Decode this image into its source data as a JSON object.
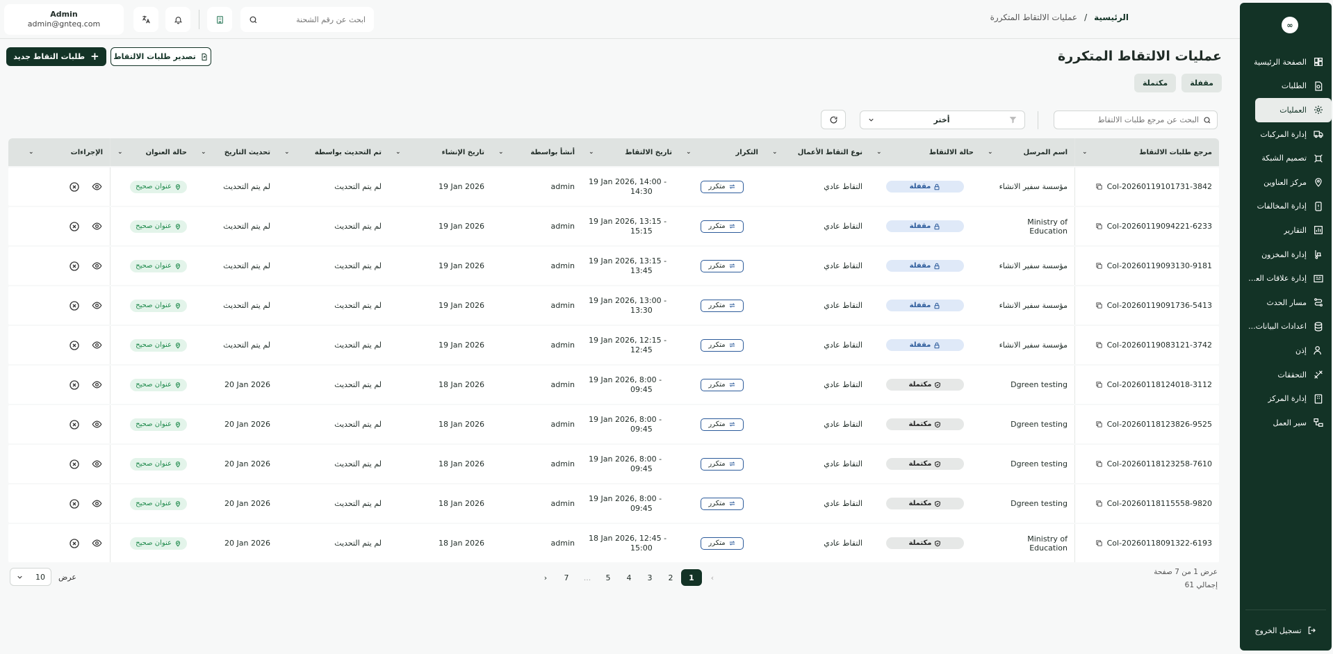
{
  "sidebar": {
    "logo": "∞",
    "items": [
      {
        "label": "الصفحة الرئيسية",
        "icon": "dashboard-icon",
        "active": false
      },
      {
        "label": "الطلبات",
        "icon": "orders-icon",
        "active": false
      },
      {
        "label": "العمليات",
        "icon": "operations-icon",
        "active": true
      },
      {
        "label": "إدارة المركبات",
        "icon": "truck-icon",
        "active": false
      },
      {
        "label": "تصميم الشبكة",
        "icon": "network-icon",
        "active": false
      },
      {
        "label": "مركز العناوين",
        "icon": "location-icon",
        "active": false
      },
      {
        "label": "إدارة المخالفات",
        "icon": "violation-icon",
        "active": false
      },
      {
        "label": "التقارير",
        "icon": "reports-icon",
        "active": false
      },
      {
        "label": "إدارة المخزون",
        "icon": "inventory-icon",
        "active": false
      },
      {
        "label": "إدارة علاقات العملاء",
        "icon": "crm-icon",
        "active": false
      },
      {
        "label": "مسار الحدث",
        "icon": "route-icon",
        "active": false
      },
      {
        "label": "اعدادات البيانات...",
        "icon": "database-icon",
        "active": false
      },
      {
        "label": "إذن",
        "icon": "users-icon",
        "active": false
      },
      {
        "label": "التحققات",
        "icon": "tools-icon",
        "active": false
      },
      {
        "label": "إدارة المركز",
        "icon": "center-icon",
        "active": false
      },
      {
        "label": "سير العمل",
        "icon": "workflow-icon",
        "active": false
      }
    ],
    "logout": "تسجيل الخروج"
  },
  "header": {
    "user_name": "Admin",
    "user_email": "admin@gnteq.com",
    "search_placeholder": "ابحث عن رقم الشحنة",
    "breadcrumb_home": "الرئيسية",
    "breadcrumb_sep": "/",
    "breadcrumb_current": "عمليات الالتقاط المتكررة"
  },
  "page": {
    "title": "عمليات الالتقاط المتكررة",
    "new_button": "طلبات التقاط جديد",
    "export_button": "تصدير طلبات الالتقاط",
    "tabs": [
      "مقفلة",
      "مكتملة"
    ],
    "search_placeholder": "البحث عن مرجع طلبات الالتقاط",
    "select_value": "أختر"
  },
  "table": {
    "headers": [
      "مرجع طلبات الالتقاط",
      "اسم المرسل",
      "حالة الالتقاط",
      "نوع التقاط الأعمال",
      "التكرار",
      "تاريخ الالتقاط",
      "أنشأ بواسطة",
      "تاريخ الإنشاء",
      "تم التحديث بواسطة",
      "تحديث التاريخ",
      "حالة العنوان",
      "الإجراءات"
    ],
    "rows": [
      {
        "ref": "Col-20260119101731-3842",
        "sender": "مؤسسة سفير الانشاء",
        "status": "مقفلة",
        "status_kind": "closed",
        "type": "التقاط عادي",
        "repeat": "متكرر",
        "date1": "19 Jan 2026, 14:00 -",
        "date2": "14:30",
        "created_by": "admin",
        "created": "19 Jan 2026",
        "updated_by": "لم يتم التحديث",
        "updated": "لم يتم التحديث",
        "address": "عنوان صحيح"
      },
      {
        "ref": "Col-20260119094221-6233",
        "sender": "Ministry of Education",
        "status": "مقفلة",
        "status_kind": "closed",
        "type": "التقاط عادي",
        "repeat": "متكرر",
        "date1": "19 Jan 2026, 13:15 -",
        "date2": "15:15",
        "created_by": "admin",
        "created": "19 Jan 2026",
        "updated_by": "لم يتم التحديث",
        "updated": "لم يتم التحديث",
        "address": "عنوان صحيح"
      },
      {
        "ref": "Col-20260119093130-9181",
        "sender": "مؤسسة سفير الانشاء",
        "status": "مقفلة",
        "status_kind": "closed",
        "type": "التقاط عادي",
        "repeat": "متكرر",
        "date1": "19 Jan 2026, 13:15 -",
        "date2": "13:45",
        "created_by": "admin",
        "created": "19 Jan 2026",
        "updated_by": "لم يتم التحديث",
        "updated": "لم يتم التحديث",
        "address": "عنوان صحيح"
      },
      {
        "ref": "Col-20260119091736-5413",
        "sender": "مؤسسة سفير الانشاء",
        "status": "مقفلة",
        "status_kind": "closed",
        "type": "التقاط عادي",
        "repeat": "متكرر",
        "date1": "19 Jan 2026, 13:00 -",
        "date2": "13:30",
        "created_by": "admin",
        "created": "19 Jan 2026",
        "updated_by": "لم يتم التحديث",
        "updated": "لم يتم التحديث",
        "address": "عنوان صحيح"
      },
      {
        "ref": "Col-20260119083121-3742",
        "sender": "مؤسسة سفير الانشاء",
        "status": "مقفلة",
        "status_kind": "closed",
        "type": "التقاط عادي",
        "repeat": "متكرر",
        "date1": "19 Jan 2026, 12:15 -",
        "date2": "12:45",
        "created_by": "admin",
        "created": "19 Jan 2026",
        "updated_by": "لم يتم التحديث",
        "updated": "لم يتم التحديث",
        "address": "عنوان صحيح"
      },
      {
        "ref": "Col-20260118124018-3112",
        "sender": "Dgreen testing",
        "status": "مكتملة",
        "status_kind": "done",
        "type": "التقاط عادي",
        "repeat": "متكرر",
        "date1": "19 Jan 2026, 8:00 -",
        "date2": "09:45",
        "created_by": "admin",
        "created": "18 Jan 2026",
        "updated_by": "لم يتم التحديث",
        "updated": "20 Jan 2026",
        "address": "عنوان صحيح"
      },
      {
        "ref": "Col-20260118123826-9525",
        "sender": "Dgreen testing",
        "status": "مكتملة",
        "status_kind": "done",
        "type": "التقاط عادي",
        "repeat": "متكرر",
        "date1": "19 Jan 2026, 8:00 -",
        "date2": "09:45",
        "created_by": "admin",
        "created": "18 Jan 2026",
        "updated_by": "لم يتم التحديث",
        "updated": "20 Jan 2026",
        "address": "عنوان صحيح"
      },
      {
        "ref": "Col-20260118123258-7610",
        "sender": "Dgreen testing",
        "status": "مكتملة",
        "status_kind": "done",
        "type": "التقاط عادي",
        "repeat": "متكرر",
        "date1": "19 Jan 2026, 8:00 -",
        "date2": "09:45",
        "created_by": "admin",
        "created": "18 Jan 2026",
        "updated_by": "لم يتم التحديث",
        "updated": "20 Jan 2026",
        "address": "عنوان صحيح"
      },
      {
        "ref": "Col-20260118115558-9820",
        "sender": "Dgreen testing",
        "status": "مكتملة",
        "status_kind": "done",
        "type": "التقاط عادي",
        "repeat": "متكرر",
        "date1": "19 Jan 2026, 8:00 -",
        "date2": "09:45",
        "created_by": "admin",
        "created": "18 Jan 2026",
        "updated_by": "لم يتم التحديث",
        "updated": "20 Jan 2026",
        "address": "عنوان صحيح"
      },
      {
        "ref": "Col-20260118091322-6193",
        "sender": "Ministry of Education",
        "status": "مكتملة",
        "status_kind": "done",
        "type": "التقاط عادي",
        "repeat": "متكرر",
        "date1": "18 Jan 2026, 12:45 -",
        "date2": "15:00",
        "created_by": "admin",
        "created": "18 Jan 2026",
        "updated_by": "لم يتم التحديث",
        "updated": "20 Jan 2026",
        "address": "عنوان صحيح"
      }
    ]
  },
  "pagination": {
    "info": "عرض 1 من 7 صفحة",
    "total": "إجمالي 61",
    "prev": "‹",
    "next": "›",
    "pages": [
      "1",
      "2",
      "3",
      "4",
      "5",
      "...",
      "7"
    ],
    "current": "1",
    "per_page_label": "عرض",
    "per_page": "10"
  }
}
